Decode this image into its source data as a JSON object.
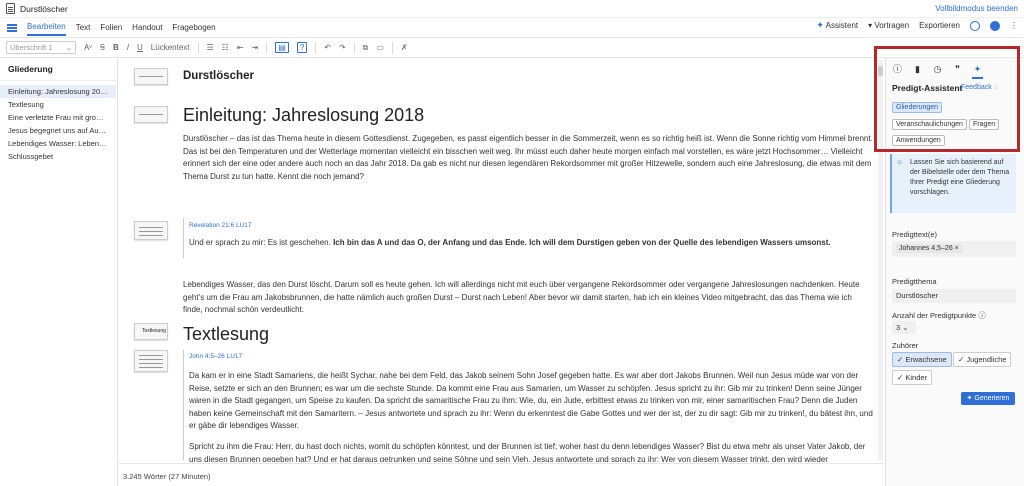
{
  "window": {
    "title": "Durstlöscher",
    "exit_fullscreen": "Vollbildmodus beenden"
  },
  "menu": {
    "items": [
      "Bearbeiten",
      "Text",
      "Folien",
      "Handout",
      "Fragebogen"
    ],
    "active": "Bearbeiten",
    "assistant": "Assistent",
    "present": "Vortragen",
    "export": "Exportieren"
  },
  "toolbar": {
    "style_select": "Überschrift 1",
    "font_size": "A",
    "bold": "B",
    "italic": "I",
    "underline": "U",
    "gap_text": "Lückentext"
  },
  "outline": {
    "title": "Gliederung",
    "items": [
      "Einleitung: Jahreslosung 2018",
      "Textlesung",
      "Eine verletzte Frau mit großem …",
      "Jesus begegnet uns auf Augenh…",
      "Lebendiges Wasser: Leben in Be…",
      "Schlussgebet"
    ]
  },
  "document": {
    "title": "Durstlöscher",
    "intro_heading": "Einleitung: Jahreslosung 2018",
    "intro_p1": "Durstlöscher – das ist das Thema heute in diesem Gottesdienst. Zugegeben, es passt eigentlich besser in die Sommerzeit, wenn es so richtig heiß ist. Wenn die Sonne richtig vom Himmel brennt. Das ist bei den Temperaturen und der Wetterlage momentan vielleicht ein bisschen weit weg. Ihr müsst euch daher heute morgen einfach mal vorstellen, es wäre jetzt Hochsommer… Vielleicht erinnert sich der eine oder andere auch noch an das Jahr 2018. Da gab es nicht nur diesen legendären Rekordsommer mit großer Hitzewelle, sondern auch eine Jahreslosung, die etwas mit dem Thema Durst zu tun hatte. Kennt die noch jemand?",
    "quote_ref": "Revelation 21:6 LU17",
    "quote_text_normal": "Und er sprach zu mir: Es ist geschehen. ",
    "quote_text_bold": "Ich bin das A und das O, der Anfang und das Ende. Ich will dem Durstigen geben von der Quelle des lebendigen Wassers umsonst.",
    "intro_p2": "Lebendiges Wasser, das den Durst löscht. Darum soll es heute gehen. Ich will allerdings nicht mit euch über vergangene Rekordsommer oder vergangene Jahreslosungen nachdenken. Heute geht’s um die Frau am Jakobsbrunnen, die hatte nämlich auch großen Durst – Durst nach Leben! Aber bevor wir damit starten, hab ich ein kleines Video mitgebracht, das das Thema wie ich finde, nochmal schön verdeutlicht.",
    "reading_heading": "Textlesung",
    "reading_ref": "John 4:5–26 LU17",
    "reading_p1": "Da kam er in eine Stadt Samariens, die heißt Sychar, nahe bei dem Feld, das Jakob seinem Sohn Josef gegeben hatte. Es war aber dort Jakobs Brunnen. Weil nun Jesus müde war von der Reise, setzte er sich an den Brunnen; es war um die sechste Stunde. Da kommt eine Frau aus Samarien, um Wasser zu schöpfen. Jesus spricht zu ihr: Gib mir zu trinken! Denn seine Jünger waren in die Stadt gegangen, um Speise zu kaufen. Da spricht die samaritische Frau zu ihm: Wie, du, ein Jude, erbittest etwas zu trinken von mir, einer samaritischen Frau? Denn die Juden haben keine Gemeinschaft mit den Samaritern. – Jesus antwortete und sprach zu ihr: Wenn du erkenntest die Gabe Gottes und wer der ist, der zu dir sagt: Gib mir zu trinken!, du bätest ihn, und er gäbe dir lebendiges Wasser.",
    "reading_p2": "Spricht zu ihm die Frau: Herr, du hast doch nichts, womit du schöpfen könntest, und der Brunnen ist tief; woher hast du denn lebendiges Wasser? Bist du etwa mehr als unser Vater Jakob, der uns diesen Brunnen gegeben hat? Und er hat daraus getrunken und seine Söhne und sein Vieh. Jesus antwortete und sprach zu ihr: Wer von diesem Wasser trinkt, den wird wieder",
    "thumb_label": "Textlesung"
  },
  "status": {
    "word_count": "3.245 Wörter (27 Minuten)"
  },
  "panel": {
    "title": "Predigt-Assistent",
    "feedback": "Feedback",
    "chips": [
      "Gliederungen",
      "Veranschaulichungen",
      "Fragen",
      "Anwendungen"
    ],
    "active_chip": "Gliederungen",
    "info": "Lassen Sie sich basierend auf der Bibelstelle oder dem Thema Ihrer Predigt eine Gliederung vorschlagen.",
    "text_label": "Predigttext(e)",
    "text_value": "Johannes 4,5–26",
    "theme_label": "Predigtthema",
    "theme_value": "Durstlöscher",
    "points_label": "Anzahl der Predigtpunkte",
    "points_value": "3",
    "audience_label": "Zuhörer",
    "audience": [
      "Erwachsene",
      "Jugendliche",
      "Kinder"
    ],
    "generate": "Generieren"
  },
  "colors": {
    "accent": "#2f6fd6",
    "highlight_box": "#b5282d"
  }
}
